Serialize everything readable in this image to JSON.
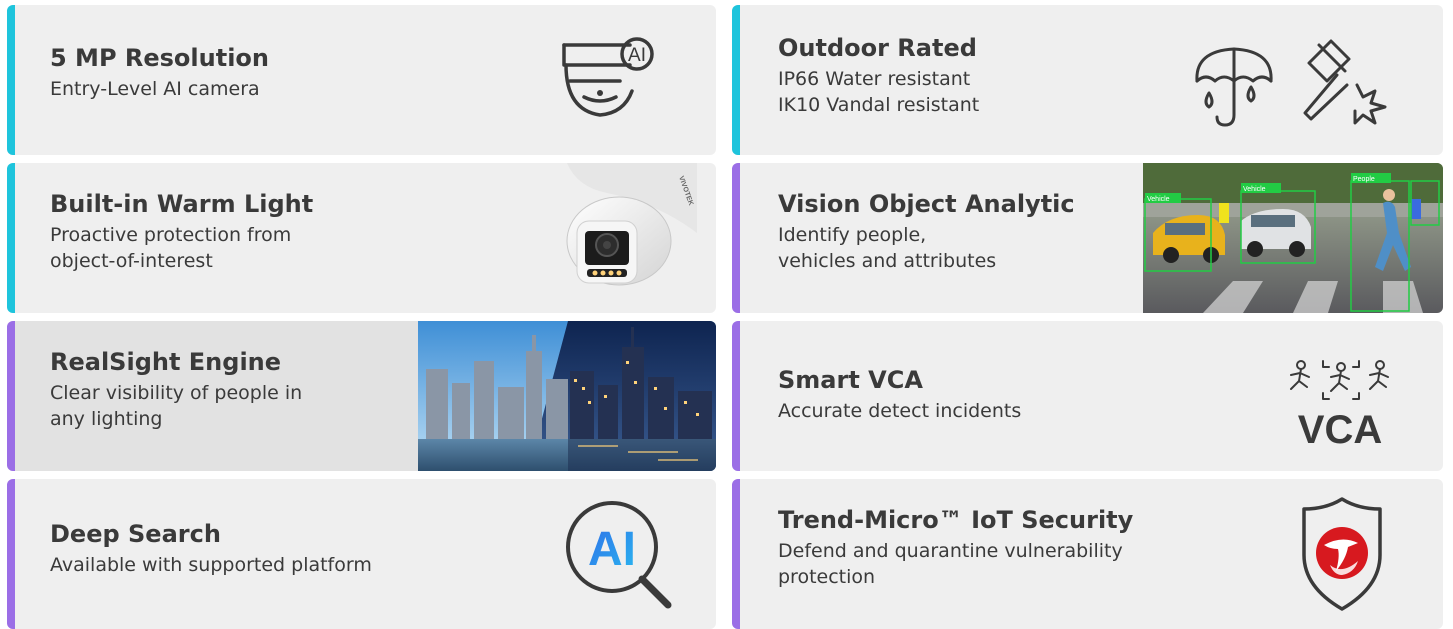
{
  "colors": {
    "cyan": "#1ec4dc",
    "purple": "#9b6ee6",
    "card_bg": "#efefef",
    "text": "#3a3a3a",
    "trend_red": "#d7191f"
  },
  "features": {
    "f1": {
      "title": "5 MP Resolution",
      "desc": "Entry-Level AI camera",
      "icon": "dome-camera-ai-icon",
      "icon_text": "AI"
    },
    "f2": {
      "title": "Outdoor Rated",
      "desc": "IP66 Water resistant\nIK10 Vandal resistant",
      "icon": "umbrella-and-hammer-icons"
    },
    "f3": {
      "title": "Built-in Warm Light",
      "desc": "Proactive protection from\nobject-of-interest",
      "icon": "turret-camera-image",
      "brand_text": "VIVOTEK"
    },
    "f4": {
      "title": "Vision Object Analytic",
      "desc": "Identify people,\nvehicles and attributes",
      "icon": "object-analytic-image",
      "box_labels": [
        "Vehicle",
        "Vehicle",
        "People"
      ]
    },
    "f5": {
      "title": "RealSight Engine",
      "desc": "Clear visibility of people in\nany lighting",
      "icon": "city-skyline-image"
    },
    "f6": {
      "title": "Smart VCA",
      "desc": "Accurate detect incidents",
      "icon": "vca-icon",
      "icon_text": "VCA"
    },
    "f7": {
      "title": "Deep Search",
      "desc": "Available with supported platform",
      "icon": "ai-search-icon",
      "icon_text": "AI"
    },
    "f8": {
      "title": "Trend-Micro™ IoT Security",
      "desc": "Defend and quarantine vulnerability\nprotection",
      "icon": "trend-micro-shield-icon"
    }
  }
}
